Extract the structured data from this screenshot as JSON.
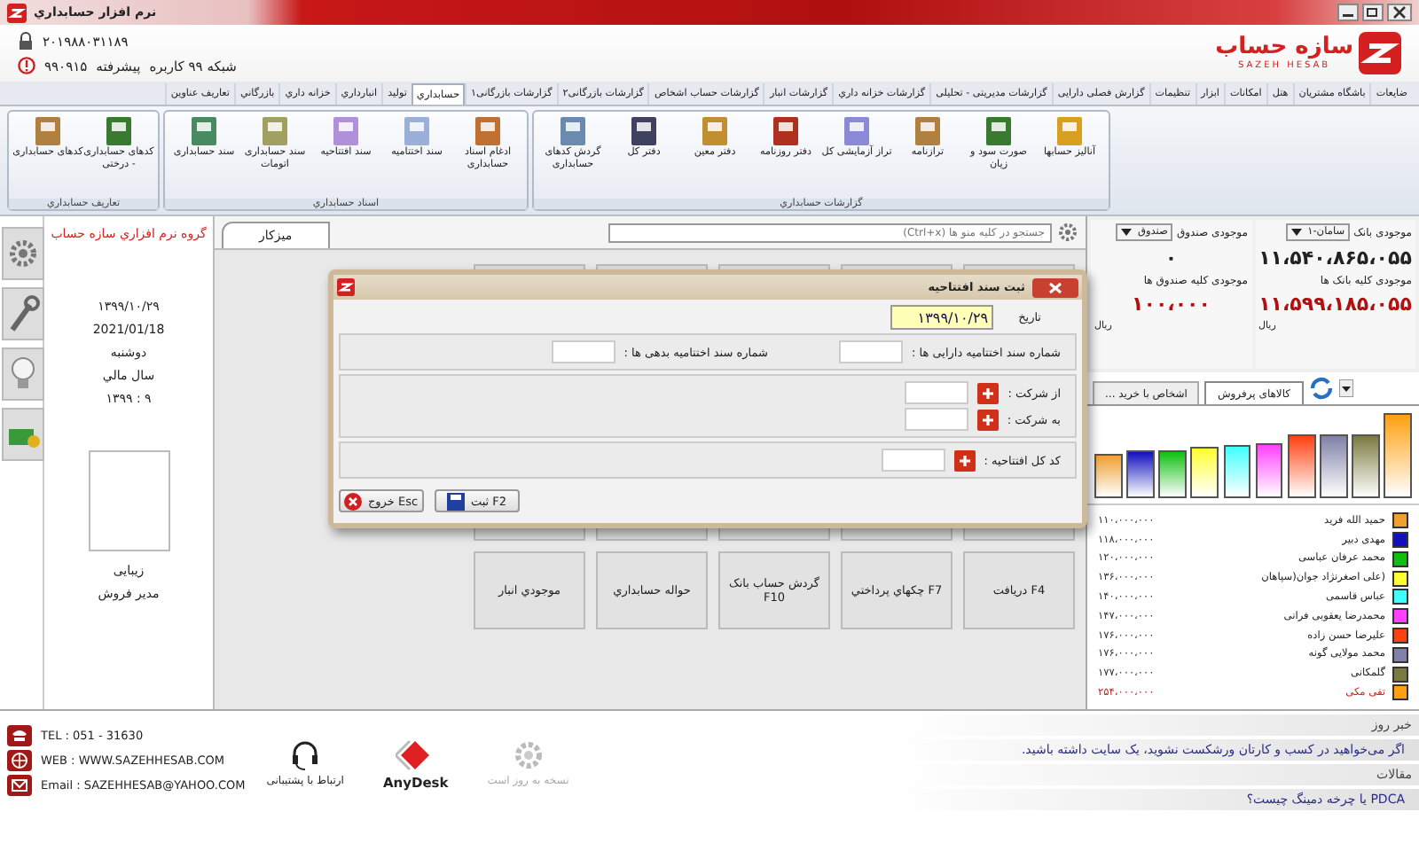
{
  "window": {
    "title": "نرم افزار حسابداري"
  },
  "license": {
    "serial": "۲۰۱۹۸۸۰۳۱۱۸۹",
    "edition": "شبکه ۹۹ کاربره",
    "tier": "پیشرفته",
    "code": "۹۹۰۹۱۵"
  },
  "logo": {
    "name": "سازه حساب",
    "latin": "SAZEH HESAB"
  },
  "menu_tabs": [
    {
      "label": "ضایعات",
      "selected": false
    },
    {
      "label": "باشگاه مشتریان",
      "selected": false
    },
    {
      "label": "هتل",
      "selected": false
    },
    {
      "label": "امکانات",
      "selected": false
    },
    {
      "label": "ابزار",
      "selected": false
    },
    {
      "label": "تنظیمات",
      "selected": false
    },
    {
      "label": "گزارش فصلی دارایی",
      "selected": false
    },
    {
      "label": "گزارشات مدیریتی - تحلیلی",
      "selected": false
    },
    {
      "label": "گزارشات خزانه داري",
      "selected": false
    },
    {
      "label": "گزارشات انبار",
      "selected": false
    },
    {
      "label": "گزارشات حساب اشخاص",
      "selected": false
    },
    {
      "label": "گزارشات بازرگانی۲",
      "selected": false
    },
    {
      "label": "گزارشات بازرگانی۱",
      "selected": false
    },
    {
      "label": "حسابداري",
      "selected": true
    },
    {
      "label": "تولید",
      "selected": false
    },
    {
      "label": "انبارداري",
      "selected": false
    },
    {
      "label": "خزانه داري",
      "selected": false
    },
    {
      "label": "بازرگاني",
      "selected": false
    },
    {
      "label": "تعاريف عناوين",
      "selected": false
    }
  ],
  "ribbon_groups": [
    {
      "title": "گزارشات حسابداري",
      "items": [
        "آنالیز حسابها",
        "صورت سود و زیان",
        "ترازنامه",
        "تراز آزمایشی کل",
        "دفتر روزنامه",
        "دفتر معین",
        "دفتر کل",
        "گردش کدهای حسابداری"
      ]
    },
    {
      "title": "اسناد حسابداري",
      "items": [
        "ادغام اسناد حسابداری",
        "سند اختتامیه",
        "سند افتتاحیه",
        "سند حسابداری اتومات",
        "سند حسابداری"
      ]
    },
    {
      "title": "تعاريف حسابداري",
      "items": [
        "کدهای حسابداری - درختی",
        "کدهای حسابداری"
      ]
    }
  ],
  "info_panel": {
    "company": "گروه نرم افزاري سازه حساب",
    "date_fa": "۱۳۹۹/۱۰/۲۹",
    "date_en": "2021/01/18",
    "weekday": "دوشنبه",
    "fiscal_label": "سال مالي",
    "fiscal_year": "۹ : ۱۳۹۹",
    "user_name": "زیبایی",
    "user_role": "مدیر فروش"
  },
  "workspace": {
    "tab": "میزکار",
    "search_placeholder": "جستجو در کلیه منو ها (Ctrl+x)",
    "tiles": [
      {
        "label": "F4 دریافت"
      },
      {
        "label": "F7 چکهاي پرداختي"
      },
      {
        "label": "گردش حساب بانک F10"
      },
      {
        "label": "حواله حسابداري"
      },
      {
        "label": "موجودي انبار"
      }
    ]
  },
  "balances": {
    "bank_label": "موجودی بانک",
    "bank_select": "سامان-۱",
    "cash_label": "موجودی صندوق",
    "cash_select": "صندوق",
    "bank_amount": "۱۱،۵۴۰،۸۶۵،۰۵۵",
    "cash_amount": "۰",
    "all_banks_label": "موجودی کلیه بانک ها",
    "all_cash_label": "موجودی کلیه صندوق ها",
    "all_banks_amount": "۱۱،۵۹۹،۱۸۵،۰۵۵",
    "all_cash_amount": "۱۰۰،۰۰۰",
    "bank_currency": "ریال",
    "cash_currency": "ریال"
  },
  "top_sellers": {
    "tabs": [
      {
        "label": "کالاهای پرفروش",
        "selected": true
      },
      {
        "label": "... اشخاص با خرید",
        "selected": false
      }
    ],
    "items": [
      {
        "name": "حمید الله فرید",
        "value": "۱۱۰،۰۰۰،۰۰۰",
        "color": "#f0a030",
        "highlighted": false
      },
      {
        "name": "مهدی دبیر",
        "value": "۱۱۸،۰۰۰،۰۰۰",
        "color": "#1010c0",
        "highlighted": false
      },
      {
        "name": "محمد عرفان عباسی",
        "value": "۱۲۰،۰۰۰،۰۰۰",
        "color": "#10c010",
        "highlighted": false
      },
      {
        "name": "(علی اصغرنژاد جوان(سپاهان",
        "value": "۱۳۶،۰۰۰،۰۰۰",
        "color": "#ffff30",
        "highlighted": false
      },
      {
        "name": "عباس قاسمی",
        "value": "۱۴۰،۰۰۰،۰۰۰",
        "color": "#40ffff",
        "highlighted": false
      },
      {
        "name": "محمدرضا یعقوبی فرانی",
        "value": "۱۴۷،۰۰۰،۰۰۰",
        "color": "#ff40ff",
        "highlighted": false
      },
      {
        "name": "علیرضا حسن زاده",
        "value": "۱۷۶،۰۰۰،۰۰۰",
        "color": "#ff4010",
        "highlighted": false
      },
      {
        "name": "محمد مولایی گونه",
        "value": "۱۷۶،۰۰۰،۰۰۰",
        "color": "#8080a8",
        "highlighted": false
      },
      {
        "name": "گلمکانی",
        "value": "۱۷۷،۰۰۰،۰۰۰",
        "color": "#7a7a40",
        "highlighted": false
      },
      {
        "name": "تقی مکی",
        "value": "۲۵۴،۰۰۰،۰۰۰",
        "color": "#ffa010",
        "highlighted": true
      }
    ]
  },
  "dialog": {
    "title": "ثبت سند افتتاحیه",
    "date_label": "تاریخ",
    "date_value": "۱۳۹۹/۱۰/۲۹",
    "sections": [
      {
        "fields": [
          {
            "label": "شماره سند اختتامیه دارایی ها :",
            "kind": "number"
          },
          {
            "label": "شماره سند اختتامیه بدهی ها :",
            "kind": "number"
          }
        ],
        "kind": "inline"
      },
      {
        "fields": [
          {
            "label": "از شرکت :",
            "kind": "lookup"
          },
          {
            "label": "به شرکت :",
            "kind": "lookup"
          }
        ],
        "kind": "stacked"
      },
      {
        "fields": [
          {
            "label": "کد کل افتتاحیه :",
            "kind": "lookup"
          }
        ],
        "kind": "stacked"
      }
    ],
    "buttons": [
      {
        "label": "ثبت F2",
        "kind": "save"
      },
      {
        "label": "خروج Esc",
        "kind": "exit"
      }
    ]
  },
  "contacts": [
    {
      "kind": "phone",
      "text": "TEL : 051 - 31630"
    },
    {
      "kind": "web",
      "text": "WEB : WWW.SAZEHHESAB.COM"
    },
    {
      "kind": "email",
      "text": "Email : SAZEHHESAB@YAHOO.COM"
    }
  ],
  "support": [
    {
      "kind": "update",
      "label": "نسخه به روز است"
    },
    {
      "kind": "anydesk",
      "label": "AnyDesk"
    },
    {
      "kind": "headset",
      "label": "ارتباط با پشتیبانی"
    }
  ],
  "news": {
    "title": "خبر روز",
    "text": "اگر می‌خواهید در کسب و کارتان ورشکست نشوید، یک سایت داشته باشید.",
    "articles_title": "مقالات",
    "article": "PDCA یا چرخه دمینگ چیست؟"
  }
}
